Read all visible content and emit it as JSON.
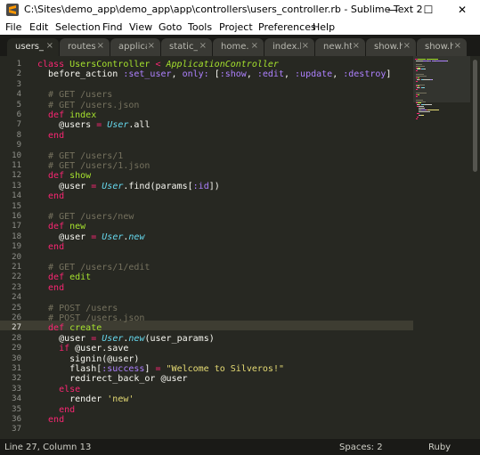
{
  "window": {
    "title": "C:\\Sites\\demo_app\\demo_app\\app\\controllers\\users_controller.rb - Sublime Text 2",
    "minimize": "—",
    "maximize": "☐",
    "close": "✕"
  },
  "menu": [
    "File",
    "Edit",
    "Selection",
    "Find",
    "View",
    "Goto",
    "Tools",
    "Project",
    "Preferences",
    "Help"
  ],
  "tabs": [
    {
      "label": "users_controller.rb",
      "close": "×"
    },
    {
      "label": "routes.rb",
      "close": "×"
    },
    {
      "label": "application.html.erb",
      "close": "×"
    },
    {
      "label": "static_pages_controller.rb",
      "close": "×"
    },
    {
      "label": "home.html.erb",
      "close": "×"
    },
    {
      "label": "index.html.erb",
      "close": "×"
    },
    {
      "label": "new.html.erb",
      "close": "×"
    },
    {
      "label": "show.html.erb",
      "close": "×"
    },
    {
      "label": "show.html.erb",
      "close": "×"
    }
  ],
  "editor": {
    "line_numbers": [
      "1",
      "2",
      "3",
      "4",
      "5",
      "6",
      "7",
      "8",
      "9",
      "10",
      "11",
      "12",
      "13",
      "14",
      "15",
      "16",
      "17",
      "18",
      "19",
      "20",
      "21",
      "22",
      "23",
      "24",
      "25",
      "26",
      "27",
      "28",
      "29",
      "30",
      "31",
      "32",
      "33",
      "34",
      "35",
      "36",
      "37"
    ],
    "current_line": "27",
    "code": [
      [
        {
          "t": "class ",
          "c": "kw"
        },
        {
          "t": "UsersController",
          "c": "cls"
        },
        {
          "t": " < ",
          "c": "kw"
        },
        {
          "t": "ApplicationController",
          "c": "inh"
        }
      ],
      [
        {
          "t": "  before_action ",
          "c": "pl"
        },
        {
          "t": ":set_user",
          "c": "sym"
        },
        {
          "t": ", ",
          "c": "pl"
        },
        {
          "t": "only:",
          "c": "sym"
        },
        {
          "t": " [",
          "c": "pl"
        },
        {
          "t": ":show",
          "c": "sym"
        },
        {
          "t": ", ",
          "c": "pl"
        },
        {
          "t": ":edit",
          "c": "sym"
        },
        {
          "t": ", ",
          "c": "pl"
        },
        {
          "t": ":update",
          "c": "sym"
        },
        {
          "t": ", ",
          "c": "pl"
        },
        {
          "t": ":destroy",
          "c": "sym"
        },
        {
          "t": "]",
          "c": "pl"
        }
      ],
      [],
      [
        {
          "t": "  # GET /users",
          "c": "cm"
        }
      ],
      [
        {
          "t": "  # GET /users.json",
          "c": "cm"
        }
      ],
      [
        {
          "t": "  def ",
          "c": "kw"
        },
        {
          "t": "index",
          "c": "fn"
        }
      ],
      [
        {
          "t": "    @users ",
          "c": "pl"
        },
        {
          "t": "=",
          "c": "kw"
        },
        {
          "t": " ",
          "c": "pl"
        },
        {
          "t": "User",
          "c": "ty"
        },
        {
          "t": ".all",
          "c": "pl"
        }
      ],
      [
        {
          "t": "  end",
          "c": "kw"
        }
      ],
      [],
      [
        {
          "t": "  # GET /users/1",
          "c": "cm"
        }
      ],
      [
        {
          "t": "  # GET /users/1.json",
          "c": "cm"
        }
      ],
      [
        {
          "t": "  def ",
          "c": "kw"
        },
        {
          "t": "show",
          "c": "fn"
        }
      ],
      [
        {
          "t": "    @user ",
          "c": "pl"
        },
        {
          "t": "=",
          "c": "kw"
        },
        {
          "t": " ",
          "c": "pl"
        },
        {
          "t": "User",
          "c": "ty"
        },
        {
          "t": ".find(params[",
          "c": "pl"
        },
        {
          "t": ":id",
          "c": "sym"
        },
        {
          "t": "])",
          "c": "pl"
        }
      ],
      [
        {
          "t": "  end",
          "c": "kw"
        }
      ],
      [],
      [
        {
          "t": "  # GET /users/new",
          "c": "cm"
        }
      ],
      [
        {
          "t": "  def ",
          "c": "kw"
        },
        {
          "t": "new",
          "c": "fn"
        }
      ],
      [
        {
          "t": "    @user ",
          "c": "pl"
        },
        {
          "t": "=",
          "c": "kw"
        },
        {
          "t": " ",
          "c": "pl"
        },
        {
          "t": "User",
          "c": "ty"
        },
        {
          "t": ".",
          "c": "pl"
        },
        {
          "t": "new",
          "c": "ty"
        }
      ],
      [
        {
          "t": "  end",
          "c": "kw"
        }
      ],
      [],
      [
        {
          "t": "  # GET /users/1/edit",
          "c": "cm"
        }
      ],
      [
        {
          "t": "  def ",
          "c": "kw"
        },
        {
          "t": "edit",
          "c": "fn"
        }
      ],
      [
        {
          "t": "  end",
          "c": "kw"
        }
      ],
      [],
      [
        {
          "t": "  # POST /users",
          "c": "cm"
        }
      ],
      [
        {
          "t": "  # POST /users.json",
          "c": "cm"
        }
      ],
      [
        {
          "t": "  def ",
          "c": "kw"
        },
        {
          "t": "create",
          "c": "fn"
        }
      ],
      [
        {
          "t": "    @user ",
          "c": "pl"
        },
        {
          "t": "=",
          "c": "kw"
        },
        {
          "t": " ",
          "c": "pl"
        },
        {
          "t": "User",
          "c": "ty"
        },
        {
          "t": ".",
          "c": "pl"
        },
        {
          "t": "new",
          "c": "ty"
        },
        {
          "t": "(user_params)",
          "c": "pl"
        }
      ],
      [
        {
          "t": "    if ",
          "c": "kw"
        },
        {
          "t": "@user.save",
          "c": "pl"
        }
      ],
      [
        {
          "t": "      signin(@user)",
          "c": "pl"
        }
      ],
      [
        {
          "t": "      flash[",
          "c": "pl"
        },
        {
          "t": ":success",
          "c": "sym"
        },
        {
          "t": "] ",
          "c": "pl"
        },
        {
          "t": "=",
          "c": "kw"
        },
        {
          "t": " ",
          "c": "pl"
        },
        {
          "t": "\"Welcome to Silveros!\"",
          "c": "str"
        }
      ],
      [
        {
          "t": "      redirect_back_or @user",
          "c": "pl"
        }
      ],
      [
        {
          "t": "    else",
          "c": "kw"
        }
      ],
      [
        {
          "t": "      render ",
          "c": "pl"
        },
        {
          "t": "'new'",
          "c": "str"
        }
      ],
      [
        {
          "t": "    end",
          "c": "kw"
        }
      ],
      [
        {
          "t": "  end",
          "c": "kw"
        }
      ],
      []
    ]
  },
  "status": {
    "position": "Line 27, Column 13",
    "spaces": "Spaces: 2",
    "syntax": "Ruby"
  },
  "colors": {
    "background": "#272822",
    "keyword": "#f92672",
    "class_name": "#a6e22e",
    "symbol": "#ae81ff",
    "comment": "#75715e",
    "string": "#e6db74",
    "type": "#66d9ef"
  },
  "icons": {
    "app": "sublime-text-icon"
  }
}
